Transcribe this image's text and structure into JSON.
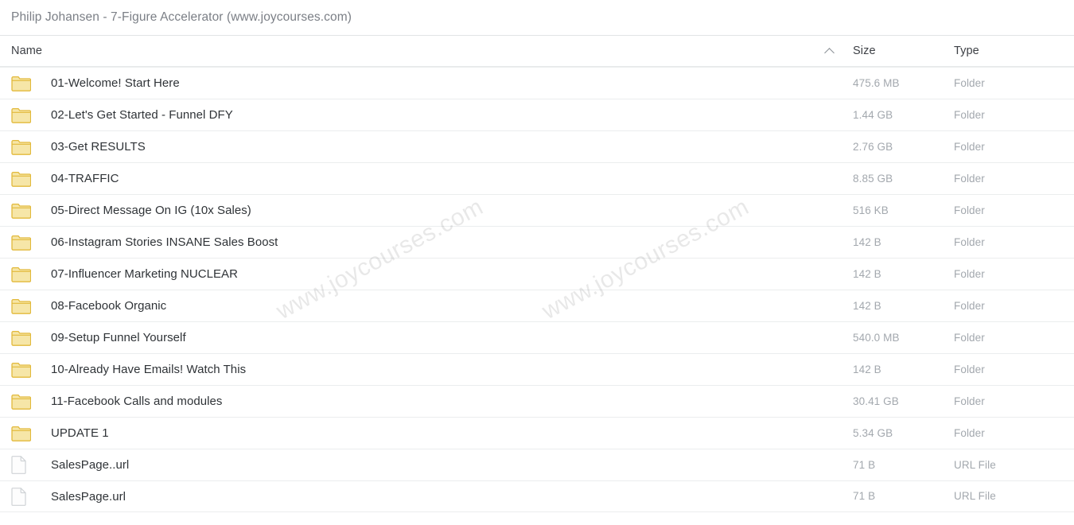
{
  "window": {
    "title": "Philip Johansen - 7-Figure Accelerator (www.joycourses.com)"
  },
  "watermarks": [
    {
      "text": "www.joycourses.com"
    },
    {
      "text": "www.joycourses.com"
    }
  ],
  "table": {
    "headers": {
      "name": "Name",
      "size": "Size",
      "type": "Type",
      "sort_icon": "chevron-up-icon",
      "sort_column": "Name",
      "sort_direction": "ascending"
    },
    "rows": [
      {
        "icon": "folder-icon",
        "name": "01-Welcome! Start Here",
        "size": "475.6 MB",
        "type": "Folder"
      },
      {
        "icon": "folder-icon",
        "name": "02-Let's Get Started - Funnel DFY",
        "size": "1.44 GB",
        "type": "Folder"
      },
      {
        "icon": "folder-icon",
        "name": "03-Get RESULTS",
        "size": "2.76 GB",
        "type": "Folder"
      },
      {
        "icon": "folder-icon",
        "name": "04-TRAFFIC",
        "size": "8.85 GB",
        "type": "Folder"
      },
      {
        "icon": "folder-icon",
        "name": "05-Direct Message On IG (10x Sales)",
        "size": "516 KB",
        "type": "Folder"
      },
      {
        "icon": "folder-icon",
        "name": "06-Instagram Stories INSANE Sales Boost",
        "size": "142 B",
        "type": "Folder"
      },
      {
        "icon": "folder-icon",
        "name": "07-Influencer Marketing NUCLEAR",
        "size": "142 B",
        "type": "Folder"
      },
      {
        "icon": "folder-icon",
        "name": "08-Facebook Organic",
        "size": "142 B",
        "type": "Folder"
      },
      {
        "icon": "folder-icon",
        "name": "09-Setup Funnel Yourself",
        "size": "540.0 MB",
        "type": "Folder"
      },
      {
        "icon": "folder-icon",
        "name": "10-Already Have Emails! Watch This",
        "size": "142 B",
        "type": "Folder"
      },
      {
        "icon": "folder-icon",
        "name": "11-Facebook Calls and modules",
        "size": "30.41 GB",
        "type": "Folder"
      },
      {
        "icon": "folder-icon",
        "name": "UPDATE 1",
        "size": "5.34 GB",
        "type": "Folder"
      },
      {
        "icon": "file-icon",
        "name": "SalesPage..url",
        "size": "71 B",
        "type": "URL File"
      },
      {
        "icon": "file-icon",
        "name": "SalesPage.url",
        "size": "71 B",
        "type": "URL File"
      }
    ]
  },
  "colors": {
    "folder_fill": "#f6e6a8",
    "folder_stroke": "#e2b93b",
    "file_fill": "#fdfdfd",
    "file_stroke": "#cfd3d6",
    "title_text": "#7b7f86",
    "row_text": "#2f3337",
    "meta_text": "#a3a8ae",
    "row_divider": "#ebedee"
  }
}
